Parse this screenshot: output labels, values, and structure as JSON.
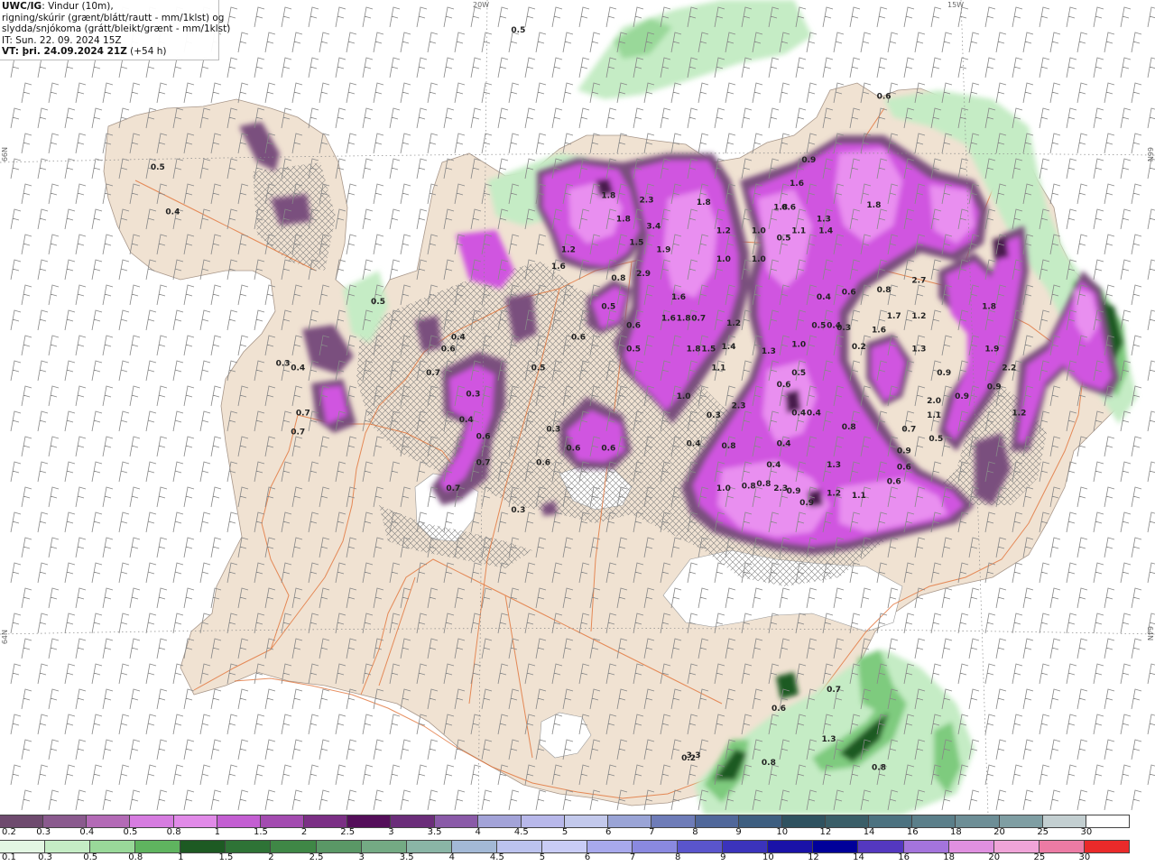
{
  "title": {
    "product": "UWC/IG",
    "desc1": ": Vindur (10m),",
    "desc2": "rigning/skúrir (grænt/blátt/rautt - mm/1klst) og",
    "desc3": "slydda/snjókoma (grátt/bleikt/grænt - mm/1klst)",
    "it": "IT: Sun. 22. 09. 2024 15Z",
    "vt": "VT: þri. 24.09.2024 21Z",
    "lead": " (+54 h)"
  },
  "grid_labels": {
    "lon_20w": "20W",
    "lon_15w": "15W",
    "lat_66n_left": "66N",
    "lat_66n_right": "66N",
    "lat_64n_left": "64N",
    "lat_64n_right": "64N"
  },
  "colors": {
    "land": "#f0e2d2",
    "sea": "#ffffff",
    "roads": "#e06a2c",
    "rivers": "#3b5bd6",
    "wind_barbs": "#888888",
    "snow_light": "#7a4f7e",
    "snow_medium": "#d055e0",
    "snow_heavy": "#e98ff0",
    "snow_peak": "#4a1f4e",
    "rain_light": "#bfeebf",
    "rain_medium": "#7ecb7e",
    "rain_heavy": "#1f6b2f"
  },
  "map_values": [
    {
      "v": "0.5",
      "lon": -19.6,
      "lat": 66.55
    },
    {
      "v": "0.6",
      "lon": -15.95,
      "lat": 66.27
    },
    {
      "v": "0.5",
      "lon": -23.2,
      "lat": 65.97
    },
    {
      "v": "0.4",
      "lon": -23.05,
      "lat": 65.78
    },
    {
      "v": "0.9",
      "lon": -16.7,
      "lat": 66.0
    },
    {
      "v": "1.6",
      "lon": -16.82,
      "lat": 65.9
    },
    {
      "v": "1.8",
      "lon": -16.98,
      "lat": 65.8
    },
    {
      "v": "1.3",
      "lon": -16.55,
      "lat": 65.75
    },
    {
      "v": "1.1",
      "lon": -16.8,
      "lat": 65.7
    },
    {
      "v": "1.8",
      "lon": -18.7,
      "lat": 65.85
    },
    {
      "v": "2.3",
      "lon": -18.32,
      "lat": 65.83
    },
    {
      "v": "1.8",
      "lon": -18.55,
      "lat": 65.75
    },
    {
      "v": "1.5",
      "lon": -18.42,
      "lat": 65.65
    },
    {
      "v": "3.4",
      "lon": -18.25,
      "lat": 65.72
    },
    {
      "v": "1.9",
      "lon": -18.15,
      "lat": 65.62
    },
    {
      "v": "2.9",
      "lon": -18.35,
      "lat": 65.52
    },
    {
      "v": "0.8",
      "lon": -18.6,
      "lat": 65.5
    },
    {
      "v": "1.6",
      "lon": -19.2,
      "lat": 65.55
    },
    {
      "v": "1.2",
      "lon": -19.1,
      "lat": 65.62
    },
    {
      "v": "0.5",
      "lon": -18.7,
      "lat": 65.38
    },
    {
      "v": "1.8",
      "lon": -17.75,
      "lat": 65.82
    },
    {
      "v": "1.2",
      "lon": -17.55,
      "lat": 65.7
    },
    {
      "v": "1.0",
      "lon": -17.55,
      "lat": 65.58
    },
    {
      "v": "1.0",
      "lon": -17.2,
      "lat": 65.7
    },
    {
      "v": "1.0",
      "lon": -17.2,
      "lat": 65.58
    },
    {
      "v": "0.6",
      "lon": -16.9,
      "lat": 65.8
    },
    {
      "v": "0.5",
      "lon": -16.95,
      "lat": 65.67
    },
    {
      "v": "1.4",
      "lon": -16.53,
      "lat": 65.7
    },
    {
      "v": "1.8",
      "lon": -16.05,
      "lat": 65.81
    },
    {
      "v": "1.6",
      "lon": -18.0,
      "lat": 65.42
    },
    {
      "v": "1.6",
      "lon": -18.1,
      "lat": 65.33
    },
    {
      "v": "1.8",
      "lon": -17.95,
      "lat": 65.33
    },
    {
      "v": "0.7",
      "lon": -17.8,
      "lat": 65.33
    },
    {
      "v": "1.2",
      "lon": -17.45,
      "lat": 65.31
    },
    {
      "v": "1.8",
      "lon": -17.85,
      "lat": 65.2
    },
    {
      "v": "1.5",
      "lon": -17.7,
      "lat": 65.2
    },
    {
      "v": "1.4",
      "lon": -17.5,
      "lat": 65.21
    },
    {
      "v": "1.1",
      "lon": -17.6,
      "lat": 65.12
    },
    {
      "v": "1.3",
      "lon": -17.1,
      "lat": 65.19
    },
    {
      "v": "1.0",
      "lon": -16.8,
      "lat": 65.22
    },
    {
      "v": "0.4",
      "lon": -16.55,
      "lat": 65.42
    },
    {
      "v": "0.6",
      "lon": -16.3,
      "lat": 65.44
    },
    {
      "v": "0.5",
      "lon": -16.6,
      "lat": 65.3
    },
    {
      "v": "0.4",
      "lon": -16.45,
      "lat": 65.3
    },
    {
      "v": "0.2",
      "lon": -16.2,
      "lat": 65.21
    },
    {
      "v": "0.3",
      "lon": -16.35,
      "lat": 65.29
    },
    {
      "v": "0.5",
      "lon": -16.8,
      "lat": 65.1
    },
    {
      "v": "0.6",
      "lon": -18.45,
      "lat": 65.3
    },
    {
      "v": "0.5",
      "lon": -18.45,
      "lat": 65.2
    },
    {
      "v": "1.0",
      "lon": -17.95,
      "lat": 65.0
    },
    {
      "v": "0.3",
      "lon": -17.65,
      "lat": 64.92
    },
    {
      "v": "2.7",
      "lon": -15.6,
      "lat": 65.49
    },
    {
      "v": "0.8",
      "lon": -15.95,
      "lat": 65.45
    },
    {
      "v": "1.7",
      "lon": -15.85,
      "lat": 65.34
    },
    {
      "v": "1.6",
      "lon": -16.0,
      "lat": 65.28
    },
    {
      "v": "1.2",
      "lon": -15.6,
      "lat": 65.34
    },
    {
      "v": "1.3",
      "lon": -15.6,
      "lat": 65.2
    },
    {
      "v": "1.8",
      "lon": -14.9,
      "lat": 65.38
    },
    {
      "v": "1.9",
      "lon": -14.87,
      "lat": 65.2
    },
    {
      "v": "2.2",
      "lon": -14.7,
      "lat": 65.12
    },
    {
      "v": "0.9",
      "lon": -14.85,
      "lat": 65.04
    },
    {
      "v": "1.2",
      "lon": -14.6,
      "lat": 64.93
    },
    {
      "v": "0.9",
      "lon": -15.35,
      "lat": 65.1
    },
    {
      "v": "0.9",
      "lon": -15.17,
      "lat": 65.0
    },
    {
      "v": "2.0",
      "lon": -15.45,
      "lat": 64.98
    },
    {
      "v": "1.1",
      "lon": -15.45,
      "lat": 64.92
    },
    {
      "v": "0.5",
      "lon": -15.43,
      "lat": 64.82
    },
    {
      "v": "0.7",
      "lon": -15.7,
      "lat": 64.86
    },
    {
      "v": "0.9",
      "lon": -15.75,
      "lat": 64.77
    },
    {
      "v": "0.6",
      "lon": -15.75,
      "lat": 64.7
    },
    {
      "v": "0.6",
      "lon": -15.85,
      "lat": 64.64
    },
    {
      "v": "0.8",
      "lon": -16.3,
      "lat": 64.87
    },
    {
      "v": "1.3",
      "lon": -16.45,
      "lat": 64.71
    },
    {
      "v": "0.4",
      "lon": -16.65,
      "lat": 64.93
    },
    {
      "v": "0.4",
      "lon": -16.8,
      "lat": 64.93
    },
    {
      "v": "0.6",
      "lon": -16.95,
      "lat": 65.05
    },
    {
      "v": "2.3",
      "lon": -17.4,
      "lat": 64.96
    },
    {
      "v": "0.4",
      "lon": -17.85,
      "lat": 64.8
    },
    {
      "v": "0.8",
      "lon": -17.5,
      "lat": 64.79
    },
    {
      "v": "0.4",
      "lon": -16.95,
      "lat": 64.8
    },
    {
      "v": "0.4",
      "lon": -17.05,
      "lat": 64.71
    },
    {
      "v": "1.0",
      "lon": -17.55,
      "lat": 64.61
    },
    {
      "v": "0.8",
      "lon": -17.3,
      "lat": 64.62
    },
    {
      "v": "0.8",
      "lon": -17.15,
      "lat": 64.63
    },
    {
      "v": "2.3",
      "lon": -16.98,
      "lat": 64.61
    },
    {
      "v": "0.9",
      "lon": -16.85,
      "lat": 64.6
    },
    {
      "v": "0.9",
      "lon": -16.72,
      "lat": 64.55
    },
    {
      "v": "1.2",
      "lon": -16.45,
      "lat": 64.59
    },
    {
      "v": "1.1",
      "lon": -16.2,
      "lat": 64.58
    },
    {
      "v": "0.4",
      "lon": -20.12,
      "lat": 64.9
    },
    {
      "v": "0.3",
      "lon": -20.05,
      "lat": 65.01
    },
    {
      "v": "0.6",
      "lon": -19.95,
      "lat": 64.83
    },
    {
      "v": "0.7",
      "lon": -19.95,
      "lat": 64.72
    },
    {
      "v": "0.6",
      "lon": -20.3,
      "lat": 65.2
    },
    {
      "v": "0.7",
      "lon": -20.45,
      "lat": 65.1
    },
    {
      "v": "0.4",
      "lon": -20.2,
      "lat": 65.25
    },
    {
      "v": "0.6",
      "lon": -19.0,
      "lat": 65.25
    },
    {
      "v": "0.3",
      "lon": -19.25,
      "lat": 64.86
    },
    {
      "v": "0.6",
      "lon": -19.05,
      "lat": 64.78
    },
    {
      "v": "0.6",
      "lon": -19.35,
      "lat": 64.72
    },
    {
      "v": "0.6",
      "lon": -18.7,
      "lat": 64.78
    },
    {
      "v": "0.7",
      "lon": -20.25,
      "lat": 64.61
    },
    {
      "v": "0.3",
      "lon": -19.6,
      "lat": 64.52
    },
    {
      "v": "0.5",
      "lon": -19.4,
      "lat": 65.12
    },
    {
      "v": "0.3",
      "lon": -21.95,
      "lat": 65.14
    },
    {
      "v": "0.4",
      "lon": -21.8,
      "lat": 65.12
    },
    {
      "v": "0.7",
      "lon": -21.75,
      "lat": 64.93
    },
    {
      "v": "0.7",
      "lon": -21.8,
      "lat": 64.85
    },
    {
      "v": "0.5",
      "lon": -21.0,
      "lat": 65.4
    },
    {
      "v": "0.7",
      "lon": -16.45,
      "lat": 63.76
    },
    {
      "v": "0.6",
      "lon": -17.0,
      "lat": 63.68
    },
    {
      "v": "0.8",
      "lon": -17.1,
      "lat": 63.45
    },
    {
      "v": "1.3",
      "lon": -16.5,
      "lat": 63.55
    },
    {
      "v": "0.8",
      "lon": -16.0,
      "lat": 63.43
    },
    {
      "v": "0.2",
      "lon": -17.9,
      "lat": 63.47
    },
    {
      "v": "3.3",
      "lon": -17.85,
      "lat": 63.48
    }
  ],
  "legend_snow": {
    "labels": [
      "0.2",
      "0.3",
      "0.4",
      "0.5",
      "0.8",
      "1",
      "1.5",
      "2",
      "2.5",
      "3",
      "3.5",
      "4",
      "4.5",
      "5",
      "6",
      "7",
      "8",
      "9",
      "10",
      "12",
      "14",
      "16",
      "18",
      "20",
      "25",
      "30"
    ],
    "colors": [
      "#6e4a6e",
      "#8a5a8e",
      "#b36ab6",
      "#d67ce0",
      "#e18ae8",
      "#c35ed2",
      "#a34bb0",
      "#7b2f85",
      "#540e5a",
      "#6b2d7a",
      "#8a5aa8",
      "#a3a3d8",
      "#b8b8ea",
      "#c3c9ec",
      "#9aa4d6",
      "#6e7cb8",
      "#50679a",
      "#3d5e80",
      "#2f5260",
      "#3a5e68",
      "#4c7280",
      "#5b7f8a",
      "#6d8e96",
      "#7f9ea3",
      "#c3cfd1",
      "#ffffff"
    ]
  },
  "legend_rain": {
    "labels": [
      "0.1",
      "0.3",
      "0.5",
      "0.8",
      "1",
      "1.5",
      "2",
      "2.5",
      "3",
      "3.5",
      "4",
      "4.5",
      "5",
      "6",
      "7",
      "8",
      "9",
      "10",
      "12",
      "14",
      "16",
      "18",
      "20",
      "25",
      "30"
    ],
    "colors": [
      "#e3f7e3",
      "#c5ecc5",
      "#99d899",
      "#5fb45f",
      "#1d5a23",
      "#2e7336",
      "#3f8746",
      "#5a9866",
      "#74aa84",
      "#8ab5a6",
      "#a3b9d6",
      "#bcc3ee",
      "#c9ccf6",
      "#a8a9ec",
      "#8a89e0",
      "#5a55cc",
      "#3b33bc",
      "#1a12a8",
      "#00009a",
      "#5438c0",
      "#a474dc",
      "#e090e0",
      "#f0a4d8",
      "#ec7ba4",
      "#ea2a2a"
    ]
  }
}
